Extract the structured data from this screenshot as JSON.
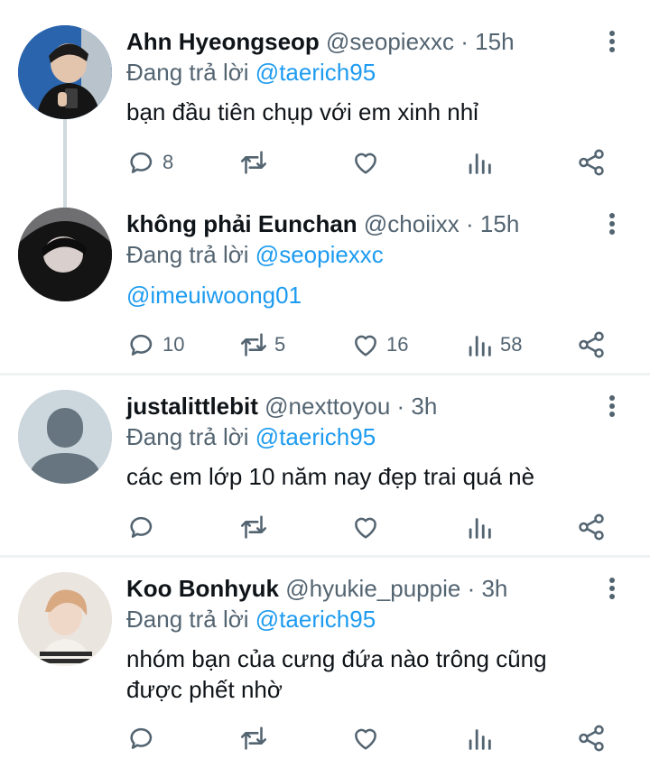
{
  "icons": {
    "reply": "reply-icon",
    "retweet": "retweet-icon",
    "like": "heart-icon",
    "views": "views-icon",
    "share": "share-icon",
    "more": "more-vertical-icon"
  },
  "colors": {
    "link": "#1d9bf0",
    "secondary_text": "#536471",
    "thread_line": "#cfd9de",
    "divider": "#eff3f4"
  },
  "tweets": [
    {
      "name": "Ahn Hyeongseop",
      "handle": "@seopiexxc",
      "time": "· 15h",
      "reply_prefix": "Đang trả lời",
      "reply_to": "@taerich95",
      "text": "bạn đầu tiên chụp với em xinh nhỉ",
      "counts": {
        "reply": "8",
        "retweet": "",
        "like": "",
        "views": ""
      }
    },
    {
      "name": "không phải Eunchan",
      "handle": "@choiixx",
      "time": "· 15h",
      "reply_prefix": "Đang trả lời",
      "reply_to": "@seopiexxc",
      "text": "@imeuiwoong01",
      "counts": {
        "reply": "10",
        "retweet": "5",
        "like": "16",
        "views": "58"
      }
    },
    {
      "name": "justalittlebit",
      "handle": "@nexttoyou",
      "time": "· 3h",
      "reply_prefix": "Đang trả lời",
      "reply_to": "@taerich95",
      "text": "các em lớp 10 năm nay đẹp trai quá nè",
      "counts": {
        "reply": "",
        "retweet": "",
        "like": "",
        "views": ""
      }
    },
    {
      "name": "Koo Bonhyuk",
      "handle": "@hyukie_puppie",
      "time": "· 3h",
      "reply_prefix": "Đang trả lời",
      "reply_to": "@taerich95",
      "text": "nhóm bạn của cưng đứa nào trông cũng được phết nhờ",
      "counts": {
        "reply": "",
        "retweet": "",
        "like": "",
        "views": ""
      }
    }
  ]
}
